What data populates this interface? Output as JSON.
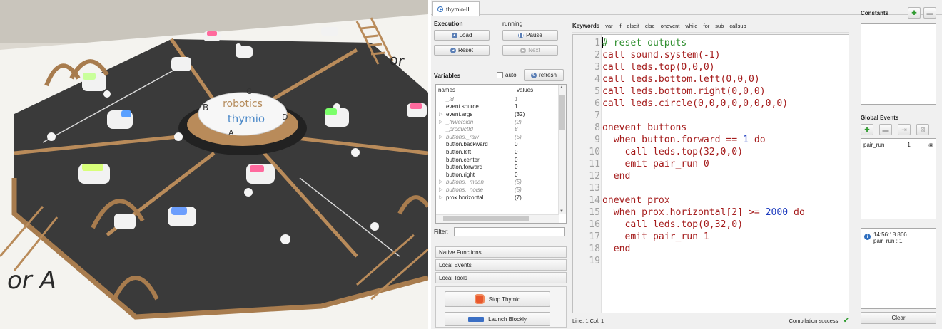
{
  "tab": {
    "label": "thymio-II"
  },
  "execution": {
    "title": "Execution",
    "status": "running",
    "load": "Load",
    "pause": "Pause",
    "reset": "Reset",
    "next": "Next"
  },
  "variables": {
    "title": "Variables",
    "auto": "auto",
    "refresh": "refresh",
    "col_names": "names",
    "col_values": "values",
    "rows": [
      {
        "name": "_id",
        "value": "1",
        "italic": true,
        "expandable": false
      },
      {
        "name": "event.source",
        "value": "1",
        "italic": false,
        "expandable": false
      },
      {
        "name": "event.args",
        "value": "(32)",
        "italic": false,
        "expandable": true
      },
      {
        "name": "_fwversion",
        "value": "(2)",
        "italic": true,
        "expandable": true
      },
      {
        "name": "_productId",
        "value": "8",
        "italic": true,
        "expandable": false
      },
      {
        "name": "buttons._raw",
        "value": "(5)",
        "italic": true,
        "expandable": true
      },
      {
        "name": "button.backward",
        "value": "0",
        "italic": false,
        "expandable": false
      },
      {
        "name": "button.left",
        "value": "0",
        "italic": false,
        "expandable": false
      },
      {
        "name": "button.center",
        "value": "0",
        "italic": false,
        "expandable": false
      },
      {
        "name": "button.forward",
        "value": "0",
        "italic": false,
        "expandable": false
      },
      {
        "name": "button.right",
        "value": "0",
        "italic": false,
        "expandable": false
      },
      {
        "name": "buttons._mean",
        "value": "(5)",
        "italic": true,
        "expandable": true
      },
      {
        "name": "buttons._noise",
        "value": "(5)",
        "italic": true,
        "expandable": true
      },
      {
        "name": "prox.horizontal",
        "value": "(7)",
        "italic": false,
        "expandable": true
      }
    ],
    "filter_label": "Filter:"
  },
  "sections": {
    "native_functions": "Native Functions",
    "local_events": "Local Events",
    "local_tools": "Local Tools"
  },
  "tools": {
    "stop": "Stop Thymio",
    "blockly": "Launch Blockly"
  },
  "keywords": {
    "title": "Keywords",
    "items": [
      "var",
      "if",
      "elseif",
      "else",
      "onevent",
      "while",
      "for",
      "sub",
      "callsub"
    ]
  },
  "code": [
    {
      "n": "1",
      "segs": [
        [
          "cm",
          "# reset outputs"
        ]
      ]
    },
    {
      "n": "2",
      "segs": [
        [
          "kw",
          "call sound.system(-1)"
        ]
      ]
    },
    {
      "n": "3",
      "segs": [
        [
          "kw",
          "call leds.top(0,0,0)"
        ]
      ]
    },
    {
      "n": "4",
      "segs": [
        [
          "kw",
          "call leds.bottom.left(0,0,0)"
        ]
      ]
    },
    {
      "n": "5",
      "segs": [
        [
          "kw",
          "call leds.bottom.right(0,0,0)"
        ]
      ]
    },
    {
      "n": "6",
      "segs": [
        [
          "kw",
          "call leds.circle(0,0,0,0,0,0,0,0)"
        ]
      ]
    },
    {
      "n": "7",
      "segs": []
    },
    {
      "n": "8",
      "segs": [
        [
          "kw",
          "onevent buttons"
        ]
      ]
    },
    {
      "n": "9",
      "segs": [
        [
          "kw",
          "  when button.forward == "
        ],
        [
          "nb",
          "1"
        ],
        [
          "kw",
          " do"
        ]
      ]
    },
    {
      "n": "10",
      "segs": [
        [
          "kw",
          "    call leds.top(32,0,0)"
        ]
      ]
    },
    {
      "n": "11",
      "segs": [
        [
          "kw",
          "    emit pair_run 0"
        ]
      ]
    },
    {
      "n": "12",
      "segs": [
        [
          "kw",
          "  end"
        ]
      ]
    },
    {
      "n": "13",
      "segs": []
    },
    {
      "n": "14",
      "segs": [
        [
          "kw",
          "onevent prox"
        ]
      ]
    },
    {
      "n": "15",
      "segs": [
        [
          "kw",
          "  when prox.horizontal[2] >= "
        ],
        [
          "nb",
          "2000"
        ],
        [
          "kw",
          " do"
        ]
      ]
    },
    {
      "n": "16",
      "segs": [
        [
          "kw",
          "    call leds.top(0,32,0)"
        ]
      ]
    },
    {
      "n": "17",
      "segs": [
        [
          "kw",
          "    emit pair_run 1"
        ]
      ]
    },
    {
      "n": "18",
      "segs": [
        [
          "kw",
          "  end"
        ]
      ]
    },
    {
      "n": "19",
      "segs": []
    }
  ],
  "statusbar": {
    "position": "Line: 1 Col: 1",
    "message": "Compilation success."
  },
  "constants": {
    "title": "Constants"
  },
  "global_events": {
    "title": "Global Events",
    "rows": [
      {
        "name": "pair_run",
        "count": "1"
      }
    ]
  },
  "log": {
    "time": "14:56:18.866",
    "message": "pair_run : 1"
  },
  "clear": "Clear",
  "photo": {
    "board_text_1": "robotics",
    "board_text_2": "thymio",
    "letters": [
      "A",
      "B",
      "C",
      "D"
    ],
    "floor_text": "or A",
    "floor_text_2": "or"
  },
  "colors": {
    "accent": "#2f6fbf",
    "keyword_red": "#a51c1c",
    "comment_green": "#2f8f2f",
    "number_blue": "#1f3dbf",
    "success_green": "#2e9a2e"
  }
}
